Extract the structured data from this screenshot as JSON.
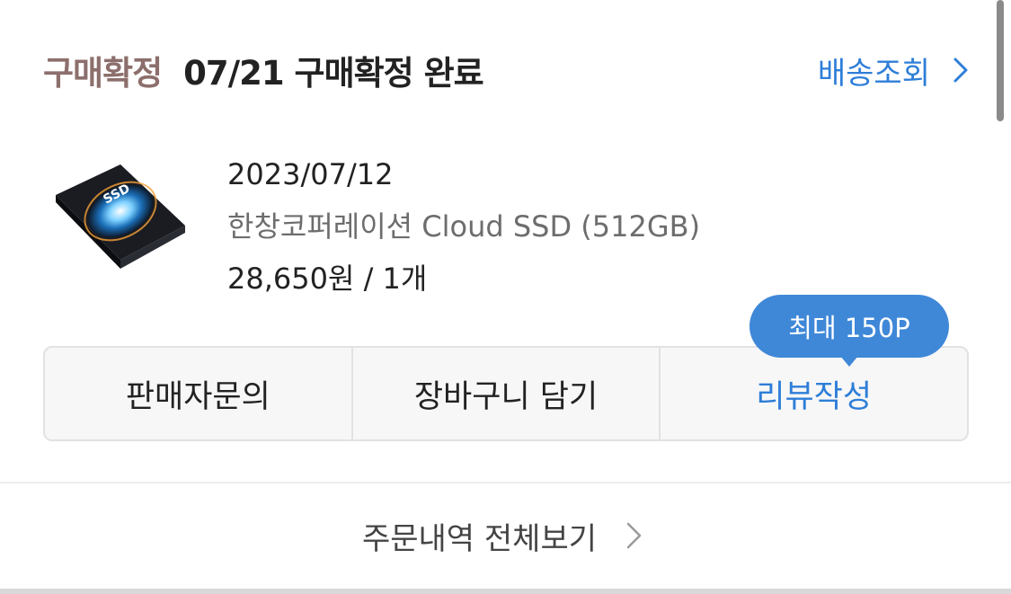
{
  "header": {
    "status_label": "구매확정",
    "status_text": "07/21 구매확정 완료",
    "track_link": "배송조회"
  },
  "product": {
    "order_date": "2023/07/12",
    "name": "한창코퍼레이션 Cloud SSD (512GB)",
    "price_qty": "28,650원 / 1개",
    "thumb_text": "SSD"
  },
  "actions": {
    "seller_inquiry": "판매자문의",
    "add_to_cart": "장바구니 담기",
    "write_review": "리뷰작성",
    "review_badge": "최대 150P"
  },
  "footer": {
    "view_all": "주문내역 전체보기"
  },
  "colors": {
    "accent": "#2e7ed8",
    "status": "#8c6f6c",
    "badge": "#3f88d8"
  },
  "icons": {
    "track_chevron": "chevron-right-icon",
    "view_all_chevron": "chevron-right-icon",
    "thumbnail": "ssd-product-image"
  }
}
